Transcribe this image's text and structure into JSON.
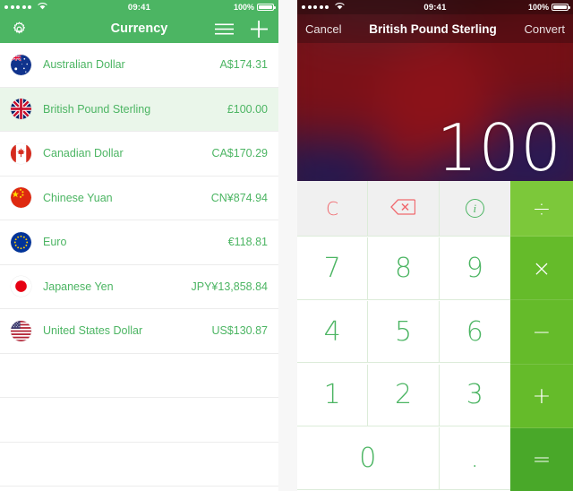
{
  "left_phone": {
    "status_bar": {
      "signal_dots": 5,
      "wifi": "wifi-icon",
      "time": "09:41",
      "battery_percent": "100%"
    },
    "navbar": {
      "settings_icon": "gear-icon",
      "title": "Currency",
      "menu_icon": "hamburger-menu-icon",
      "add_icon": "plus-icon"
    },
    "currencies": [
      {
        "flag": "australia",
        "name": "Australian Dollar",
        "amount": "A$174.31",
        "selected": false
      },
      {
        "flag": "uk",
        "name": "British Pound Sterling",
        "amount": "£100.00",
        "selected": true
      },
      {
        "flag": "canada",
        "name": "Canadian Dollar",
        "amount": "CA$170.29",
        "selected": false
      },
      {
        "flag": "china",
        "name": "Chinese Yuan",
        "amount": "CN¥874.94",
        "selected": false
      },
      {
        "flag": "eu",
        "name": "Euro",
        "amount": "€118.81",
        "selected": false
      },
      {
        "flag": "japan",
        "name": "Japanese Yen",
        "amount": "JPY¥13,858.84",
        "selected": false
      },
      {
        "flag": "usa",
        "name": "United States Dollar",
        "amount": "US$130.87",
        "selected": false
      }
    ],
    "empty_rows": 3
  },
  "right_phone": {
    "status_bar": {
      "signal_dots": 5,
      "wifi": "wifi-icon",
      "time": "09:41",
      "battery_percent": "100%"
    },
    "navbar": {
      "cancel_label": "Cancel",
      "title": "British Pound Sterling",
      "convert_label": "Convert"
    },
    "display": {
      "value": "100"
    },
    "keypad": {
      "clear_label": "C",
      "backspace_icon": "backspace-icon",
      "info_icon": "info-circle-icon",
      "digits": [
        "7",
        "8",
        "9",
        "4",
        "5",
        "6",
        "1",
        "2",
        "3"
      ],
      "zero_label": "0",
      "decimal_label": ".",
      "operators": [
        "÷",
        "×",
        "−",
        "+",
        "="
      ]
    }
  },
  "colors": {
    "brand_green": "#4cb563",
    "operator_green": "#65bb2a",
    "selected_row": "#eaf6ea",
    "red_accent": "#f0696e",
    "hero_maroon": "#5d1216"
  }
}
